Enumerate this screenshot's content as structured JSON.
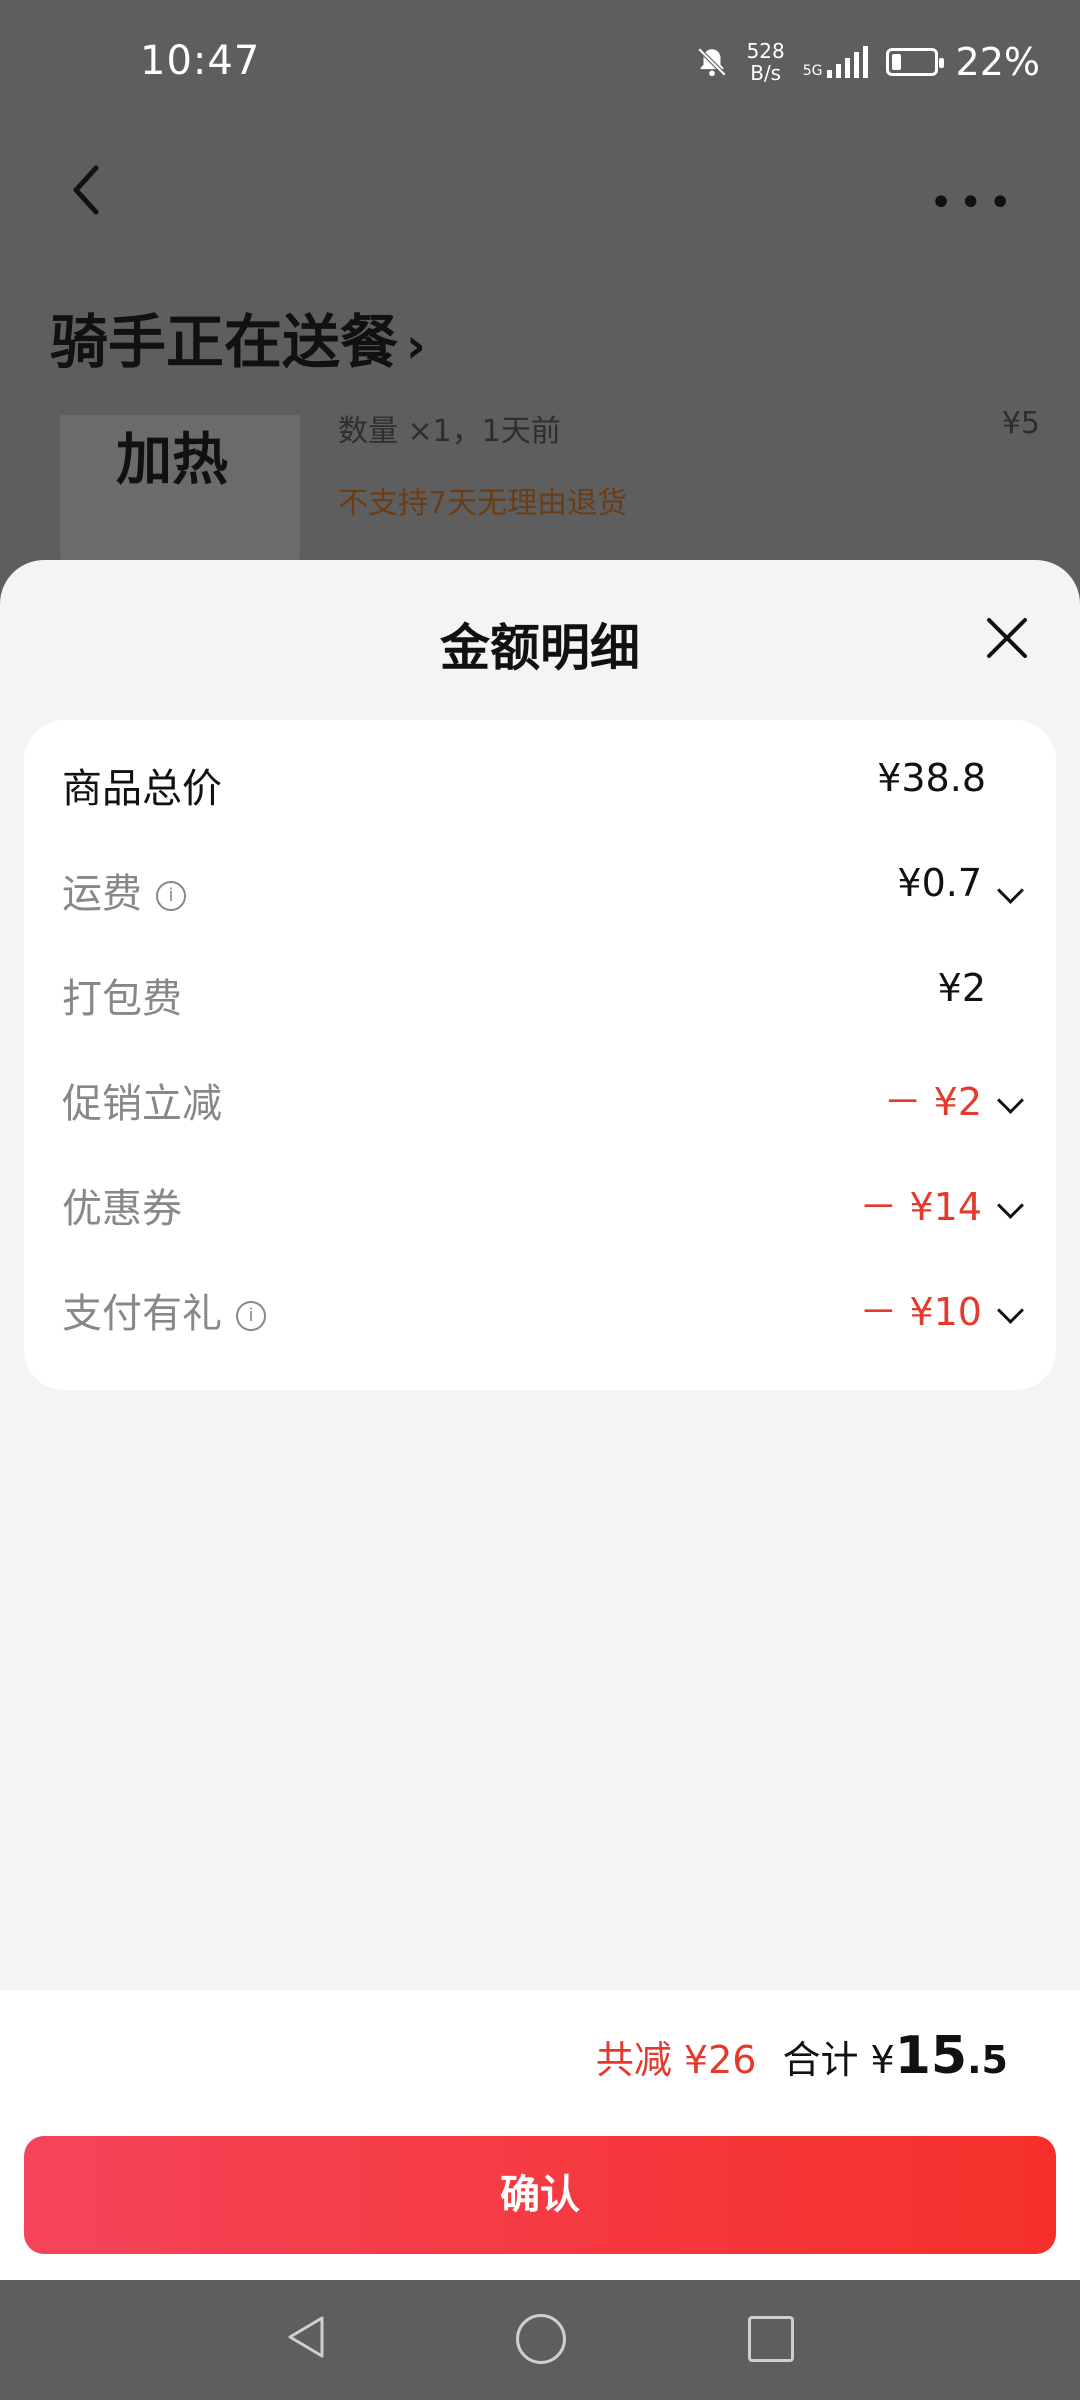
{
  "status_bar": {
    "time": "10:47",
    "net_speed_top": "528",
    "net_speed_bottom": "B/s",
    "network": "5G",
    "battery": "22%",
    "battery_level": 0.22,
    "icons": [
      "bell-off-icon",
      "signal-icon",
      "battery-charging-icon"
    ]
  },
  "page": {
    "title": "骑手正在送餐",
    "title_chevron": "›",
    "more": "•••",
    "product": {
      "thumb_text": "加热",
      "detail": "数量 ×1，1天前",
      "price": "¥5",
      "note": "不支持7天无理由退货"
    }
  },
  "sheet": {
    "title": "金额明细",
    "rows": [
      {
        "label": "商品总价",
        "value": "¥38.8"
      },
      {
        "label": "运费",
        "value": "¥0.7"
      },
      {
        "label": "打包费",
        "value": "¥2"
      },
      {
        "label": "促销立减",
        "value": "－ ¥2"
      },
      {
        "label": "优惠券",
        "value": "－ ¥14"
      },
      {
        "label": "支付有礼",
        "value": "－ ¥10"
      }
    ],
    "info_glyph": "i"
  },
  "summary": {
    "saved": "共减 ¥26",
    "total_label": "合计 ¥",
    "total_int": "15",
    "total_dec": ".5"
  },
  "confirm_label": "确认",
  "colors": {
    "accent_red": "#e33a2d",
    "button_gradient_start": "#f5445a",
    "button_gradient_end": "#f5302a",
    "overlay": "#5e5e5e"
  }
}
